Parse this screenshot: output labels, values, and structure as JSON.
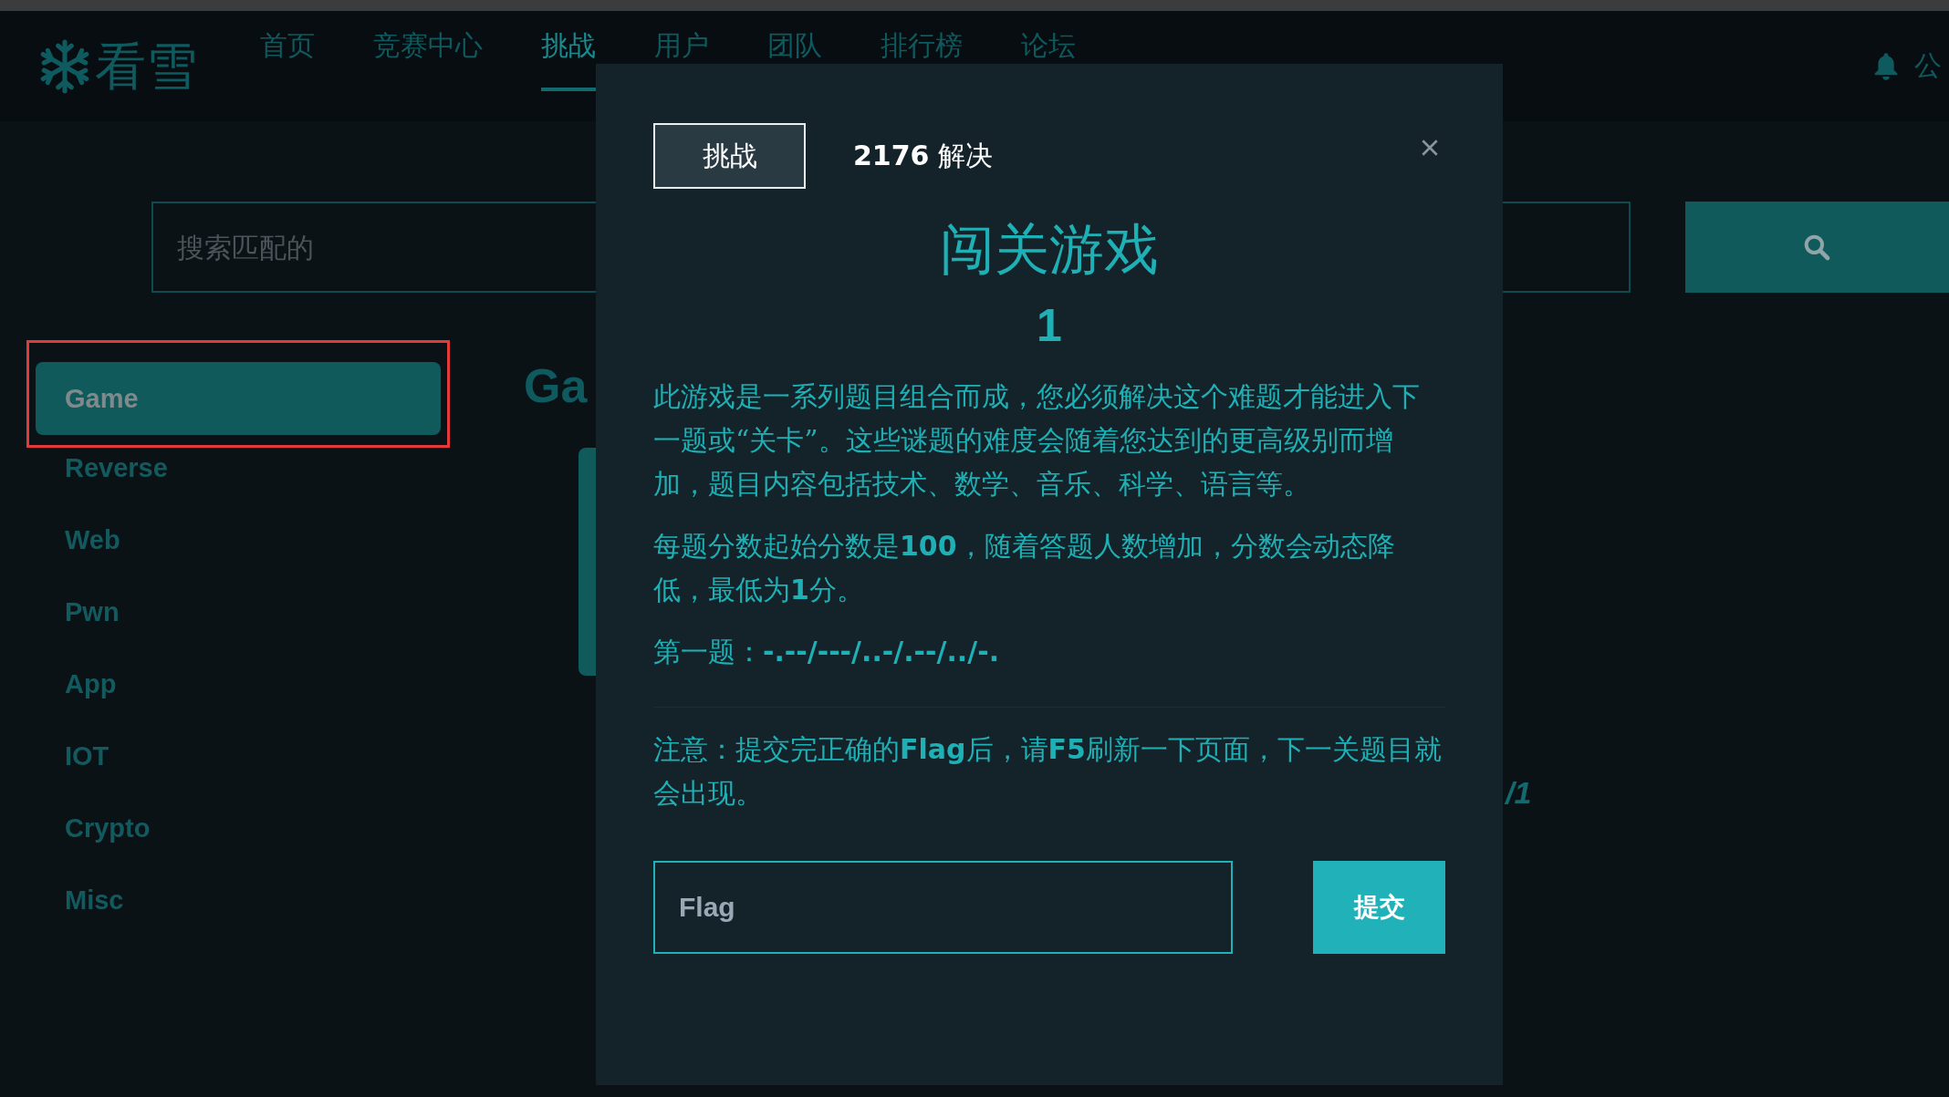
{
  "nav": {
    "logo": "看雪",
    "items": [
      {
        "label": "首页",
        "selected": false
      },
      {
        "label": "竞赛中心",
        "selected": false
      },
      {
        "label": "挑战",
        "selected": true
      },
      {
        "label": "用户",
        "selected": false
      },
      {
        "label": "团队",
        "selected": false
      },
      {
        "label": "排行榜",
        "selected": false
      },
      {
        "label": "论坛",
        "selected": false
      }
    ],
    "notice": "公"
  },
  "search": {
    "placeholder": "搜索匹配的"
  },
  "sidebar": {
    "items": [
      {
        "label": "Game",
        "selected": true,
        "highlighted": true
      },
      {
        "label": "Reverse",
        "selected": false,
        "highlighted": false
      },
      {
        "label": "Web",
        "selected": false,
        "highlighted": false
      },
      {
        "label": "Pwn",
        "selected": false,
        "highlighted": false
      },
      {
        "label": "App",
        "selected": false,
        "highlighted": false
      },
      {
        "label": "IOT",
        "selected": false,
        "highlighted": false
      },
      {
        "label": "Crypto",
        "selected": false,
        "highlighted": false
      },
      {
        "label": "Misc",
        "selected": false,
        "highlighted": false
      }
    ]
  },
  "main": {
    "heading": "Ga",
    "score_fragment": "/1"
  },
  "modal": {
    "tabs": [
      {
        "label": "挑战",
        "selected": true
      },
      {
        "label": "**2176** 解决",
        "selected": false
      }
    ],
    "title": "闯关游戏",
    "value": "1",
    "paragraphs": [
      "此游戏是一系列题目组合而成，您必须解决这个难题才能进入下一题或“关卡”。这些谜题的难度会随着您达到的更高级别而增加，题目内容包括技术、数学、音乐、科学、语言等。",
      "每题分数起始分数是**100**，随着答题人数增加，分数会动态降低，最低为**1**分。",
      "第一题：**-.--/---/..-/.--/../-.**"
    ],
    "note": "注意：提交完正确的**Flag**后，请**F5**刷新一下页面，下一关题目就会出现。",
    "input": {
      "placeholder": "Flag"
    },
    "submit": "提交"
  }
}
